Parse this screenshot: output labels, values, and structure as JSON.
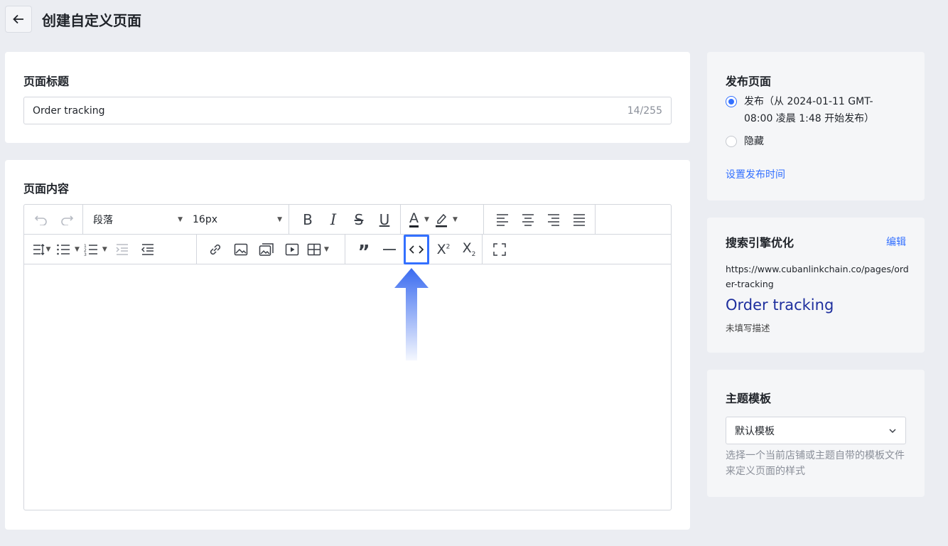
{
  "header": {
    "title": "创建自定义页面"
  },
  "title_card": {
    "label": "页面标题",
    "value": "Order tracking",
    "counter": "14/255"
  },
  "content_card": {
    "label": "页面内容",
    "toolbar": {
      "paragraph": "段落",
      "font_size": "16px"
    }
  },
  "publish": {
    "title": "发布页面",
    "options": [
      {
        "label": "发布（从 2024-01-11 GMT-08:00 凌晨 1:48 开始发布）",
        "checked": true
      },
      {
        "label": "隐藏",
        "checked": false
      }
    ],
    "schedule_link": "设置发布时间"
  },
  "seo": {
    "title": "搜索引擎优化",
    "edit_link": "编辑",
    "url": "https://www.cubanlinkchain.co/pages/order-tracking",
    "page_title": "Order tracking",
    "description": "未填写描述"
  },
  "theme": {
    "title": "主题模板",
    "selected": "默认模板",
    "hint": "选择一个当前店铺或主题自带的模板文件来定义页面的样式"
  },
  "colors": {
    "accent": "#3370ff",
    "seo_title": "#1e2f9e",
    "background": "#ebedf2"
  }
}
